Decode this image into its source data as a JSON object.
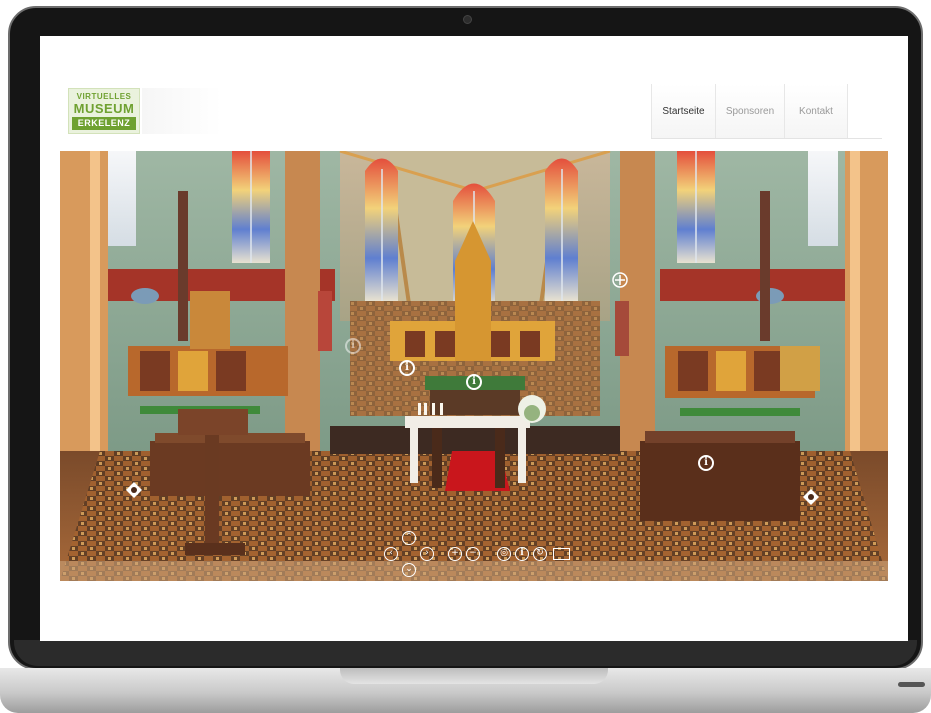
{
  "site": {
    "logo": {
      "line1": "VIRTUELLES",
      "line2": "MUSEUM",
      "line3": "ERKELENZ"
    },
    "nav": [
      {
        "label": "Startseite",
        "active": true
      },
      {
        "label": "Sponsoren",
        "active": false
      },
      {
        "label": "Kontakt",
        "active": false
      }
    ]
  },
  "panorama": {
    "info_hotspot_glyph": "i",
    "controls": {
      "up": "⌃",
      "down": "⌄",
      "left": "‹",
      "right": "›",
      "zoom_in": "+",
      "zoom_out": "−",
      "hotspots_toggle": "◎",
      "info": "i",
      "autorotate": "↻",
      "fullscreen_icon": "fullscreen-icon"
    }
  },
  "colors": {
    "brand_green": "#6fa131",
    "laptop_bezel": "#151515",
    "nav_active_text": "#333333",
    "nav_inactive_text": "#9a9a9a"
  }
}
